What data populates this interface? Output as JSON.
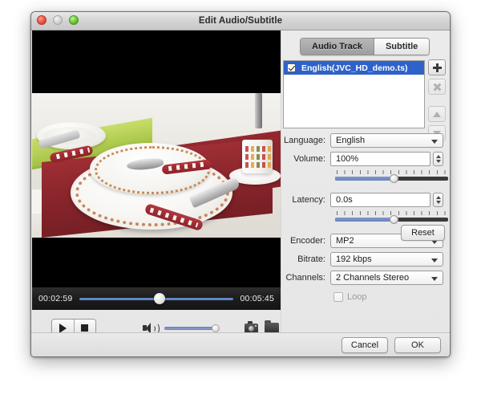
{
  "window": {
    "title": "Edit Audio/Subtitle",
    "traffic": {
      "close": "close-button",
      "minimize": "minimize-button",
      "zoom": "zoom-button"
    }
  },
  "player": {
    "current_time": "00:02:59",
    "total_time": "00:05:45",
    "progress_percent": 52,
    "volume_percent": 100,
    "buttons": {
      "play": "play-icon",
      "stop": "stop-icon",
      "speaker": "speaker-icon",
      "snapshot": "camera-icon",
      "open_folder": "folder-icon"
    }
  },
  "tabs": [
    {
      "label": "Audio Track",
      "active": true
    },
    {
      "label": "Subtitle",
      "active": false
    }
  ],
  "track_list": {
    "items": [
      {
        "label": "English(JVC_HD_demo.ts)",
        "checked": true,
        "selected": true
      }
    ],
    "tools": [
      {
        "name": "add",
        "icon": "plus-icon",
        "enabled": true
      },
      {
        "name": "remove",
        "icon": "x-icon",
        "enabled": false
      },
      {
        "name": "move-up",
        "icon": "arrow-up-icon",
        "enabled": false
      },
      {
        "name": "move-down",
        "icon": "arrow-down-icon",
        "enabled": false
      }
    ]
  },
  "form": {
    "language": {
      "label": "Language:",
      "value": "English"
    },
    "volume": {
      "label": "Volume:",
      "value": "100%",
      "slider_percent": 52
    },
    "latency": {
      "label": "Latency:",
      "value": "0.0s",
      "slider_percent": 52
    },
    "encoder": {
      "label": "Encoder:",
      "value": "MP2"
    },
    "bitrate": {
      "label": "Bitrate:",
      "value": "192 kbps"
    },
    "channels": {
      "label": "Channels:",
      "value": "2 Channels Stereo"
    },
    "loop": {
      "label": "Loop",
      "checked": false
    },
    "reset_label": "Reset"
  },
  "footer": {
    "cancel_label": "Cancel",
    "ok_label": "OK"
  },
  "colors": {
    "selection_blue": "#2f62c9",
    "slider_blue": "#6b84b9",
    "scrub_blue": "#5d86c6",
    "window_bg": "#ececec"
  }
}
